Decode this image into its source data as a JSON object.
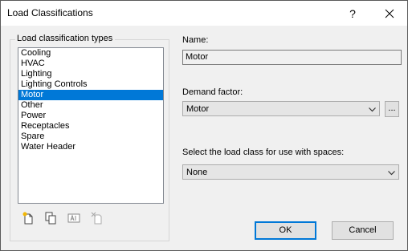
{
  "window": {
    "title": "Load Classifications",
    "help_label": "?",
    "close_label": "✕"
  },
  "types_group": {
    "legend": "Load classification types",
    "items": [
      {
        "label": "Cooling"
      },
      {
        "label": "HVAC"
      },
      {
        "label": "Lighting"
      },
      {
        "label": "Lighting Controls"
      },
      {
        "label": "Motor",
        "selected": true
      },
      {
        "label": "Other"
      },
      {
        "label": "Power"
      },
      {
        "label": "Receptacles"
      },
      {
        "label": "Spare"
      },
      {
        "label": "Water Header"
      }
    ],
    "tool_icons": [
      "new-icon",
      "duplicate-icon",
      "rename-icon",
      "delete-icon"
    ]
  },
  "name_field": {
    "label": "Name:",
    "value": "Motor"
  },
  "demand_factor": {
    "label": "Demand factor:",
    "value": "Motor",
    "browse_label": "..."
  },
  "space_load_class": {
    "label": "Select the load class for use with spaces:",
    "value": "None"
  },
  "buttons": {
    "ok": "OK",
    "cancel": "Cancel"
  },
  "colors": {
    "selection": "#0078d7",
    "dialog_background": "#f0f0f0"
  }
}
